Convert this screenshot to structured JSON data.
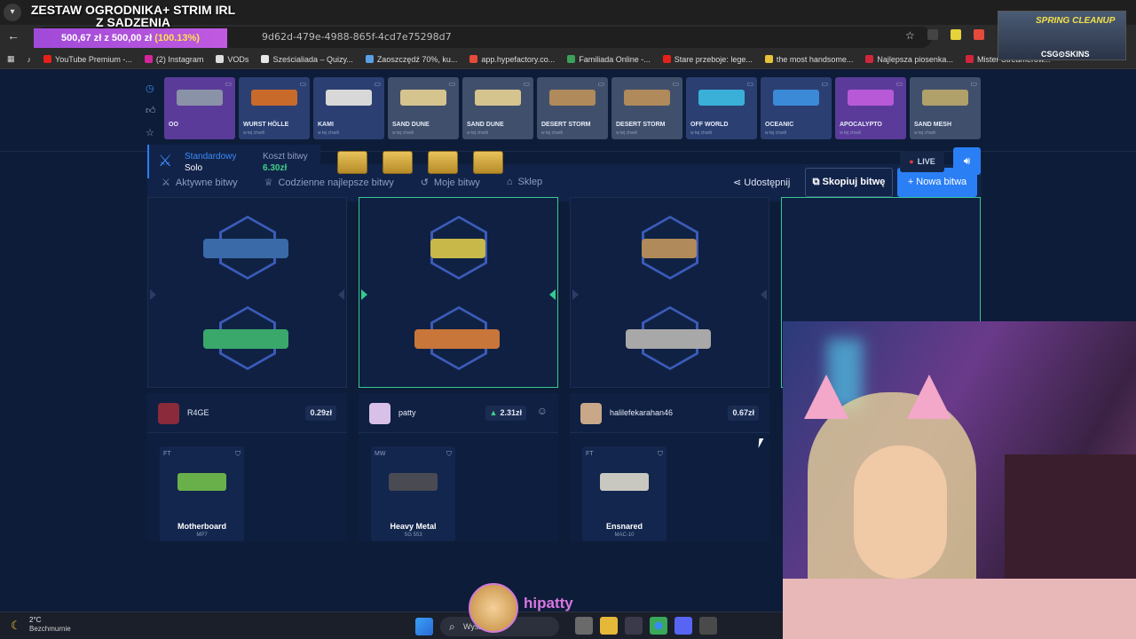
{
  "browser": {
    "url": "9d62d-479e-4988-865f-4cd7e75298d7",
    "bookmarks": [
      {
        "label": "YouTube Premium -...",
        "color": "#e62117"
      },
      {
        "label": "(2) Instagram",
        "color": "#d6249f"
      },
      {
        "label": "VODs",
        "color": "#dddddd"
      },
      {
        "label": "Sześcialiada – Quizy...",
        "color": "#e6e6e6"
      },
      {
        "label": "Zaoszczędź 70%, ku...",
        "color": "#5aa0e6"
      },
      {
        "label": "app.hypefactory.co...",
        "color": "#e64a3a"
      },
      {
        "label": "Familiada Online -...",
        "color": "#3aa05a"
      },
      {
        "label": "Stare przeboje: lege...",
        "color": "#e62117"
      },
      {
        "label": "the most handsome...",
        "color": "#e6c23a"
      },
      {
        "label": "Najlepsza piosenka...",
        "color": "#d1263a"
      },
      {
        "label": "Mister Streamerów...",
        "color": "#d1263a"
      }
    ]
  },
  "goal": {
    "title": "ZESTAW OGRODNIKA+ STRIM IRL Z SADZENIA",
    "amount": "500,67 zł",
    "separator": "z",
    "target": "500,00 zł",
    "percent": "(100.13%)"
  },
  "stream_overlay": {
    "title": "SPRING CLEANUP",
    "sponsor": "CSG⊙SKINS"
  },
  "live_drops": [
    {
      "name": "OO",
      "sub": "",
      "color": "#5b3b9a",
      "gun": "#8a92a8"
    },
    {
      "name": "WURST HÖLLE",
      "sub": "w tej chwili",
      "color": "#2c3f72",
      "gun": "#c86a2a"
    },
    {
      "name": "KAMI",
      "sub": "w tej chwili",
      "color": "#2c3f72",
      "gun": "#d8d8d8"
    },
    {
      "name": "SAND DUNE",
      "sub": "w tej chwili",
      "color": "#40506c",
      "gun": "#d6c48e"
    },
    {
      "name": "SAND DUNE",
      "sub": "w tej chwili",
      "color": "#40506c",
      "gun": "#d6c48e"
    },
    {
      "name": "DESERT STORM",
      "sub": "w tej chwili",
      "color": "#40506c",
      "gun": "#b08a5a"
    },
    {
      "name": "DESERT STORM",
      "sub": "w tej chwili",
      "color": "#40506c",
      "gun": "#b08a5a"
    },
    {
      "name": "OFF WORLD",
      "sub": "w tej chwili",
      "color": "#2c3f72",
      "gun": "#3ab0d8"
    },
    {
      "name": "OCEANIC",
      "sub": "w tej chwili",
      "color": "#2c3f72",
      "gun": "#3a8ad8"
    },
    {
      "name": "APOCALYPTO",
      "sub": "w tej chwili",
      "color": "#5b3b9a",
      "gun": "#b85ad8"
    },
    {
      "name": "SAND MESH",
      "sub": "w tej chwili",
      "color": "#40506c",
      "gun": "#b0a06a"
    }
  ],
  "nav": {
    "items": [
      "Aktywne bitwy",
      "Codzienne najlepsze bitwy",
      "Moje bitwy",
      "Sklep"
    ],
    "share": "Udostępnij",
    "copy": "Skopiuj bitwę",
    "new": "+ Nowa bitwa"
  },
  "battle": {
    "mode_label": "Standardowy",
    "mode_value": "Solo",
    "cost_label": "Koszt bitwy",
    "cost_value": "6.30zł",
    "live": "LIVE"
  },
  "players": [
    {
      "name": "R4GE",
      "value": "0.29zł",
      "winner": false,
      "avatar": "#8a2a3a",
      "guns": [
        "#3a6aa8",
        "#3aa86a"
      ],
      "drop": {
        "cond": "FT",
        "name": "Motherboard",
        "sub": "MP7",
        "gun": "#6ab04a"
      }
    },
    {
      "name": "patty",
      "value": "2.31zł",
      "winner": true,
      "avatar": "#d8c0e8",
      "guns": [
        "#c8b84a",
        "#c8763a"
      ],
      "drop": {
        "cond": "MW",
        "name": "Heavy Metal",
        "sub": "SG 553",
        "gun": "#4a4a52"
      }
    },
    {
      "name": "halilefekarahan46",
      "value": "0.67zł",
      "winner": false,
      "avatar": "#c8a888",
      "guns": [
        "#b08a5a",
        "#a8a8a8"
      ],
      "drop": {
        "cond": "FT",
        "name": "Ensnared",
        "sub": "MAC-10",
        "gun": "#c8c8c0"
      }
    }
  ],
  "taskbar": {
    "temp": "2°C",
    "weather": "Bezchmurnie",
    "search": "Wysz"
  },
  "streamer_chat": {
    "name": "hipatty"
  }
}
